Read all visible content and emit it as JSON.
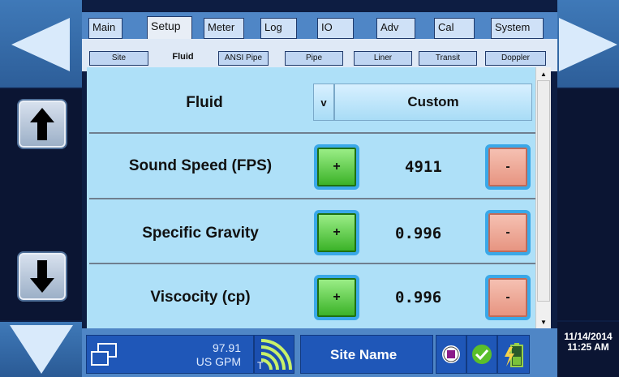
{
  "tabs_main": [
    "Main",
    "Setup",
    "Meter",
    "Log",
    "IO",
    "Adv",
    "Cal",
    "System"
  ],
  "tabs_sub": [
    "Site",
    "Fluid",
    "ANSI Pipe",
    "Pipe",
    "Liner",
    "Transit",
    "Doppler"
  ],
  "active_main_tab": "Setup",
  "active_sub_tab": "Fluid",
  "fluid": {
    "label": "Fluid",
    "dropdown_indicator": "v",
    "selected_value": "Custom"
  },
  "sound_speed": {
    "label": "Sound Speed (FPS)",
    "value": "4911",
    "plus": "+",
    "minus": "-"
  },
  "specific_gravity": {
    "label": "Specific Gravity",
    "value": "0.996",
    "plus": "+",
    "minus": "-"
  },
  "viscosity": {
    "label": "Viscocity (cp)",
    "value": "0.996",
    "plus": "+",
    "minus": "-"
  },
  "status": {
    "flow_value": "97.91",
    "flow_unit": "US GPM",
    "signal_letter": "T",
    "site_name": "Site Name",
    "date": "11/14/2014",
    "time": "11:25 AM"
  },
  "colors": {
    "panel_bg": "#aee0f8",
    "plus_green": "#37b024",
    "minus_red": "#e6937f",
    "tab_bar_blue": "#4f86c6",
    "status_blue": "#1f57b8"
  }
}
